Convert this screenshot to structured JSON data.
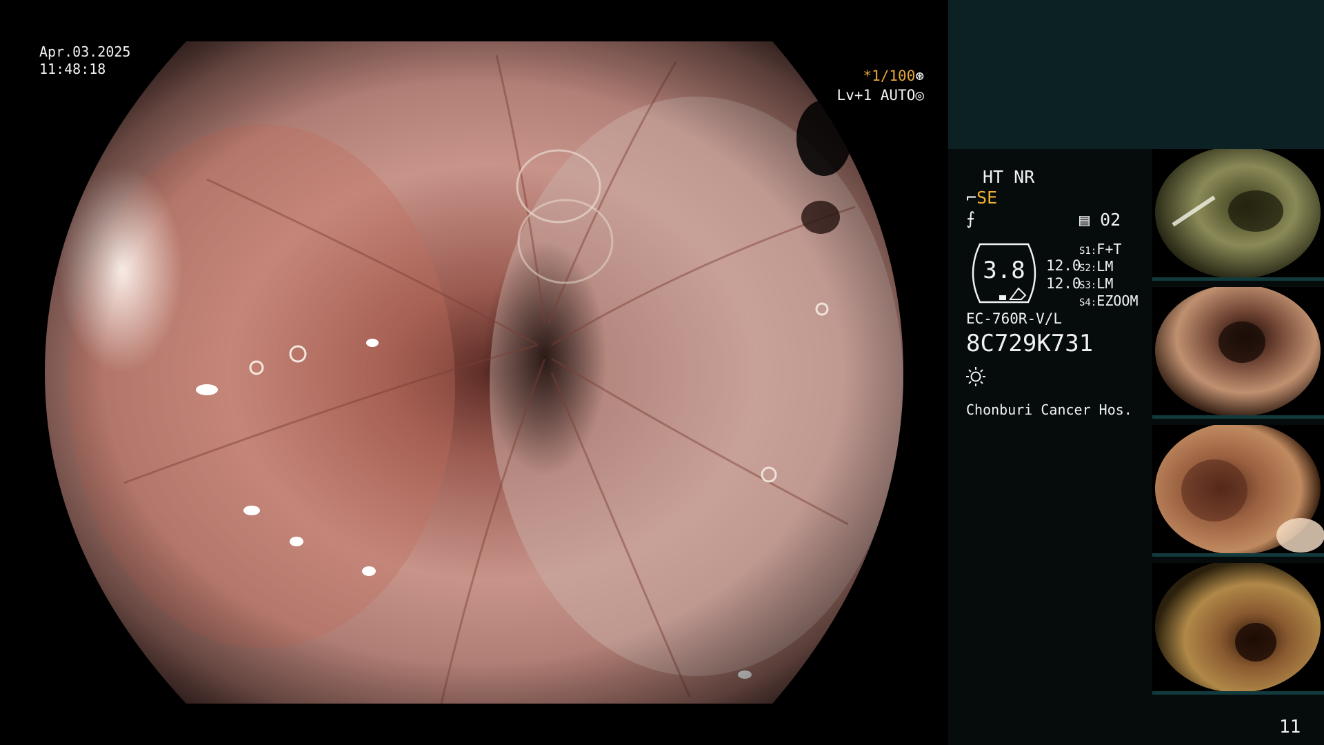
{
  "overlay": {
    "date": "Apr.03.2025",
    "time": "11:48:18",
    "shutter": "*1/100",
    "level": "Lv+1 AUTO"
  },
  "panel": {
    "ht_nr": "HT NR",
    "se_label": "SE",
    "channel": "02",
    "zoom": "3.8",
    "zoom_values": [
      "12.0",
      "12.0"
    ],
    "switches": [
      {
        "key": "S1:",
        "value": "F+T"
      },
      {
        "key": "S2:",
        "value": "LM"
      },
      {
        "key": "S3:",
        "value": "LM"
      },
      {
        "key": "S4:",
        "value": "EZOOM"
      }
    ],
    "model": "EC-760R-V/L",
    "serial": "8C729K731",
    "hospital": "Chonburi Cancer Hos.",
    "page_number": "11"
  },
  "icons": {
    "shutter": "aperture-icon",
    "level": "iris-icon",
    "scope_tip": "scope-tip-icon",
    "enhance": "enhance-icon",
    "channel": "memory-icon",
    "light": "light-icon"
  },
  "colors": {
    "accent_orange": "#e8a63a",
    "accent_yellow": "#f2b233",
    "panel_top": "#0b2123",
    "panel_bg": "#060c0c"
  }
}
